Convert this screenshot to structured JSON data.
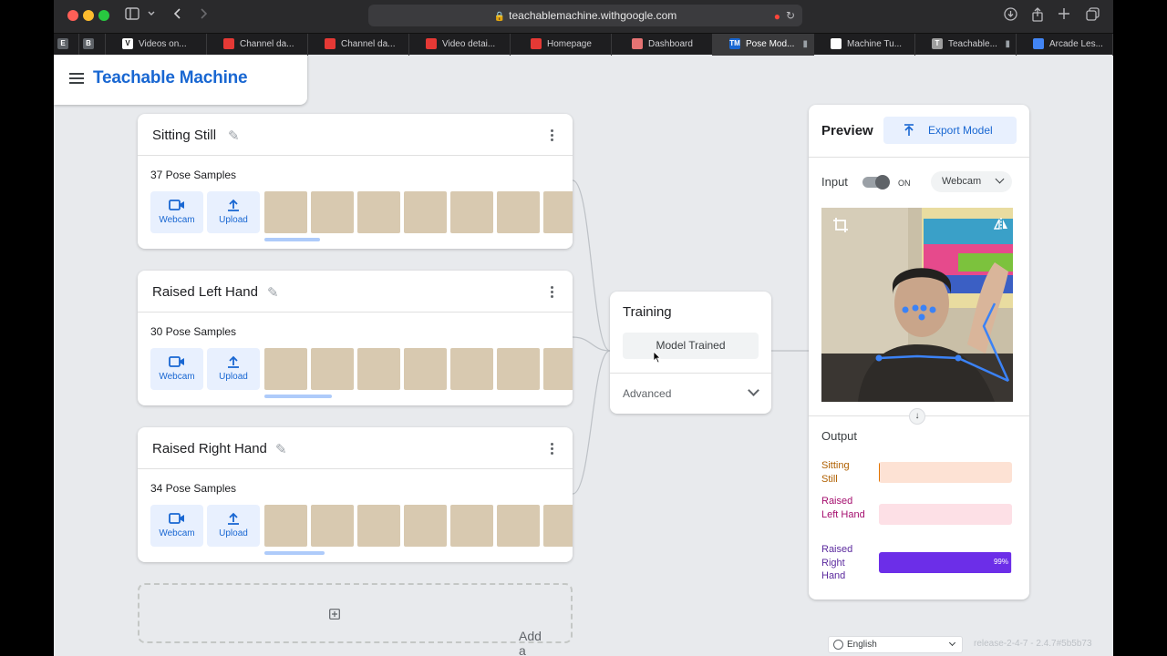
{
  "browser": {
    "url": "teachablemachine.withgoogle.com",
    "tabs": [
      {
        "label": "",
        "icon": "E",
        "color": "#5f6368"
      },
      {
        "label": "",
        "icon": "B",
        "color": "#5f6368"
      },
      {
        "label": "Videos on...",
        "icon": "V",
        "color": "#fff"
      },
      {
        "label": "Channel da...",
        "icon": "",
        "color": "#e53935"
      },
      {
        "label": "Channel da...",
        "icon": "",
        "color": "#e53935"
      },
      {
        "label": "Video detai...",
        "icon": "",
        "color": "#e53935"
      },
      {
        "label": "Homepage",
        "icon": "",
        "color": "#e53935"
      },
      {
        "label": "Dashboard",
        "icon": "",
        "color": "#e57373"
      },
      {
        "label": "Pose Mod...",
        "icon": "TM",
        "color": "#1967d2"
      },
      {
        "label": "Machine Tu...",
        "icon": "",
        "color": "#fff"
      },
      {
        "label": "Teachable...",
        "icon": "T",
        "color": "#9e9e9e"
      },
      {
        "label": "Arcade Les...",
        "icon": "",
        "color": "#4285f4"
      }
    ]
  },
  "app": {
    "title": "Teachable Machine"
  },
  "classes": [
    {
      "name": "Sitting Still",
      "samples": "37 Pose Samples",
      "scroll_fraction": 0.18
    },
    {
      "name": "Raised Left Hand",
      "samples": "30 Pose Samples",
      "scroll_fraction": 0.22
    },
    {
      "name": "Raised Right Hand",
      "samples": "34 Pose Samples",
      "scroll_fraction": 0.2
    }
  ],
  "class_buttons": {
    "webcam": "Webcam",
    "upload": "Upload"
  },
  "add_class": "Add a class",
  "training": {
    "title": "Training",
    "button": "Model Trained",
    "advanced": "Advanced"
  },
  "preview": {
    "title": "Preview",
    "export": "Export Model",
    "input_label": "Input",
    "toggle_state": "ON",
    "source": "Webcam",
    "output_label": "Output",
    "outputs": [
      {
        "label": "Sitting Still",
        "value": 0.01,
        "text_color": "#b06000",
        "bar_bg": "#fde2d4",
        "fill": "#e37400",
        "pct": ""
      },
      {
        "label": "Raised Left Hand",
        "value": 0.0,
        "text_color": "#a50e6e",
        "bar_bg": "#fde0e6",
        "fill": "#d01884",
        "pct": ""
      },
      {
        "label": "Raised Right Hand",
        "value": 0.99,
        "text_color": "#5b2a9e",
        "bar_bg": "#e9ddfc",
        "fill": "#6c2ee8",
        "pct": "99%"
      }
    ]
  },
  "footer": {
    "language": "English",
    "release": "release-2-4-7 - 2.4.7#5b5b73"
  }
}
